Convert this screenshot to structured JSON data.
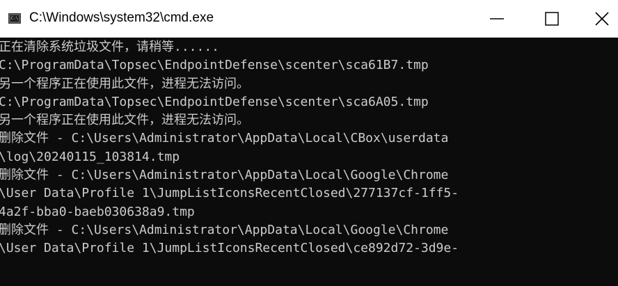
{
  "window": {
    "title": "C:\\Windows\\system32\\cmd.exe",
    "icon": "cmd-console-icon",
    "icon_text": "C:\\"
  },
  "controls": {
    "minimize_icon": "minimize-icon",
    "maximize_icon": "maximize-icon",
    "close_icon": "close-icon"
  },
  "colors": {
    "console_background": "#0c0c0c",
    "console_text": "#cccccc",
    "titlebar_background": "#ffffff"
  },
  "console": {
    "lines": [
      "正在清除系统垃圾文件，请稍等......",
      "C:\\ProgramData\\Topsec\\EndpointDefense\\scenter\\sca61B7.tmp",
      "另一个程序正在使用此文件，进程无法访问。",
      "C:\\ProgramData\\Topsec\\EndpointDefense\\scenter\\sca6A05.tmp",
      "另一个程序正在使用此文件，进程无法访问。",
      "删除文件 - C:\\Users\\Administrator\\AppData\\Local\\CBox\\userdata",
      "\\log\\20240115_103814.tmp",
      "删除文件 - C:\\Users\\Administrator\\AppData\\Local\\Google\\Chrome",
      "\\User Data\\Profile 1\\JumpListIconsRecentClosed\\277137cf-1ff5-",
      "4a2f-bba0-baeb030638a9.tmp",
      "删除文件 - C:\\Users\\Administrator\\AppData\\Local\\Google\\Chrome",
      "\\User Data\\Profile 1\\JumpListIconsRecentClosed\\ce892d72-3d9e-"
    ]
  }
}
